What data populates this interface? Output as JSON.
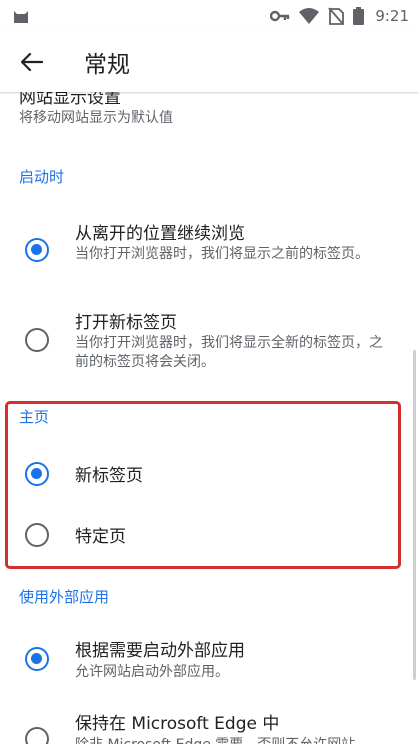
{
  "status_bar": {
    "time": "9:21",
    "icons": [
      "cat-icon",
      "key-icon",
      "wifi-icon",
      "no-sim-icon",
      "battery-icon"
    ]
  },
  "app_bar": {
    "title": "常规",
    "back_icon": "arrow-left-icon"
  },
  "site_display": {
    "title": "网站显示设置",
    "subtitle": "将移动网站显示为默认值"
  },
  "on_startup": {
    "header": "启动时",
    "options": [
      {
        "label": "从离开的位置继续浏览",
        "desc": "当你打开浏览器时，我们将显示之前的标签页。",
        "checked": true
      },
      {
        "label": "打开新标签页",
        "desc": "当你打开浏览器时，我们将显示全新的标签页，之前的标签页将会关闭。",
        "checked": false
      }
    ]
  },
  "home_page": {
    "header": "主页",
    "options": [
      {
        "label": "新标签页",
        "checked": true
      },
      {
        "label": "特定页",
        "checked": false
      }
    ]
  },
  "external_apps": {
    "header": "使用外部应用",
    "options": [
      {
        "label": "根据需要启动外部应用",
        "desc": "允许网站启动外部应用。",
        "checked": true
      },
      {
        "label": "保持在 Microsoft Edge 中",
        "desc": "除非 Microsoft Edge 需要，否则不允许网站",
        "checked": false
      }
    ]
  },
  "colors": {
    "accent": "#1a73e8",
    "highlight": "#d32f2f"
  }
}
